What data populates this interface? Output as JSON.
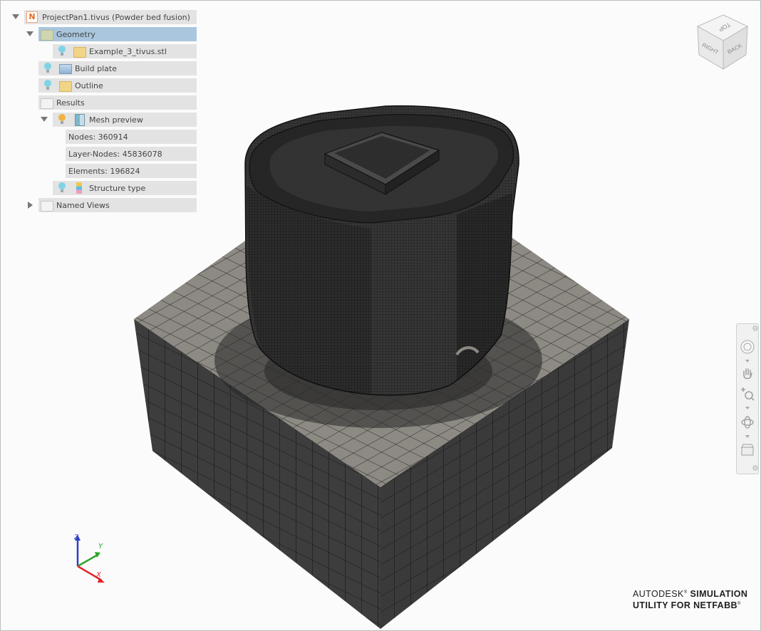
{
  "tree": {
    "project": "ProjectPan1.tivus (Powder bed fusion)",
    "geometry": "Geometry",
    "stl_file": "Example_3_tivus.stl",
    "build_plate": "Build plate",
    "outline": "Outline",
    "results": "Results",
    "mesh_preview": "Mesh preview",
    "nodes": "Nodes: 360914",
    "layer_nodes": "Layer-Nodes: 45836078",
    "elements": "Elements: 196824",
    "structure_type": "Structure type",
    "named_views": "Named Views"
  },
  "viewcube": {
    "top": "TOP",
    "right": "RIGHT",
    "back": "BACK"
  },
  "axes": {
    "x": "X",
    "y": "Y",
    "z": "Z",
    "x_color": "#e0262b",
    "y_color": "#2aa52a",
    "z_color": "#2b3fc7"
  },
  "brand": {
    "line1_a": "AUTODESK",
    "line1_reg": "®",
    "line1_b": "SIMULATION",
    "line2": "UTILITY FOR NETFABB",
    "line2_reg": "®"
  },
  "colors": {
    "selected_row": "#a9c6de",
    "row_bg": "#e3e3e3",
    "plate_top": "#8c8880",
    "plate_side": "#3b3b3b",
    "part": "#2a2a2a"
  }
}
